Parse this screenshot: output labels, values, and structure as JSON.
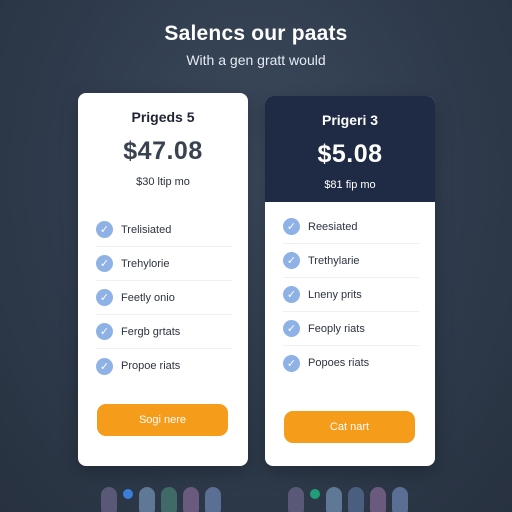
{
  "header": {
    "title": "Salencs our paats",
    "subtitle": "With a gen gratt would"
  },
  "plans": [
    {
      "name": "Prigeds 5",
      "price": "$47.08",
      "price_prefix": "$",
      "price_note": "$30 ltip mo",
      "features": [
        "Trelisiated",
        "Trehylorie",
        "Feetly onio",
        "Fergb grtats",
        "Propoe riats"
      ],
      "cta": "Sogi nere"
    },
    {
      "name": "Prigeri 3",
      "price": "$5.08",
      "price_prefix": "$",
      "price_note": "$81 fip mo",
      "features": [
        "Reesiated",
        "Trethylarie",
        "Lneny prits",
        "Feoply riats",
        "Popoes riats"
      ],
      "cta": "Cat nart"
    }
  ],
  "colors": {
    "background": "#2e3a4b",
    "featured_header": "#1f2a44",
    "accent": "#f59c1a",
    "check": "#8fb2e6"
  },
  "icons": {
    "feature": "check-icon"
  }
}
